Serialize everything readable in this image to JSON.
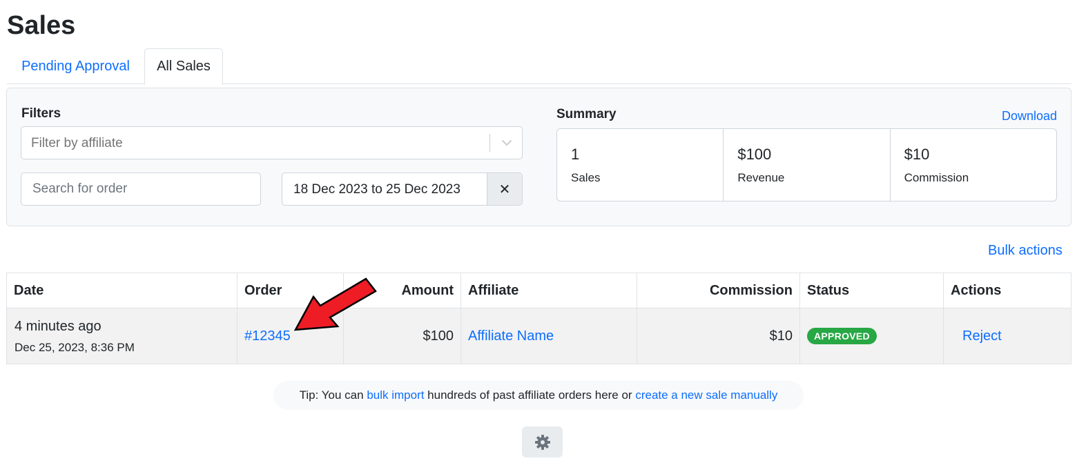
{
  "page": {
    "title": "Sales"
  },
  "tabs": [
    {
      "label": "Pending Approval",
      "active": false
    },
    {
      "label": "All Sales",
      "active": true
    }
  ],
  "filters": {
    "heading": "Filters",
    "affiliate_placeholder": "Filter by affiliate",
    "order_search_placeholder": "Search for order",
    "date_range": "18 Dec 2023 to 25 Dec 2023",
    "clear_label": "✕"
  },
  "summary": {
    "heading": "Summary",
    "download_label": "Download",
    "stats": [
      {
        "value": "1",
        "label": "Sales"
      },
      {
        "value": "$100",
        "label": "Revenue"
      },
      {
        "value": "$10",
        "label": "Commission"
      }
    ]
  },
  "bulk_actions_label": "Bulk actions",
  "table": {
    "columns": [
      "Date",
      "Order",
      "Amount",
      "Affiliate",
      "Commission",
      "Status",
      "Actions"
    ],
    "rows": [
      {
        "date_relative": "4 minutes ago",
        "date_absolute": "Dec 25, 2023, 8:36 PM",
        "order": "#12345",
        "amount": "$100",
        "affiliate": "Affiliate Name",
        "commission": "$10",
        "status": "APPROVED",
        "action": "Reject"
      }
    ]
  },
  "tip": {
    "prefix": "Tip: You can ",
    "link1": "bulk import",
    "middle": " hundreds of past affiliate orders here or ",
    "link2": "create a new sale manually"
  },
  "colors": {
    "link": "#0d6efd",
    "approved_badge": "#28a745",
    "annotation_arrow": "#ee1c25"
  },
  "icons": {
    "chevron": "chevron-down-icon",
    "clear": "close-icon",
    "settings": "gear-icon",
    "arrow": "annotation-arrow"
  }
}
